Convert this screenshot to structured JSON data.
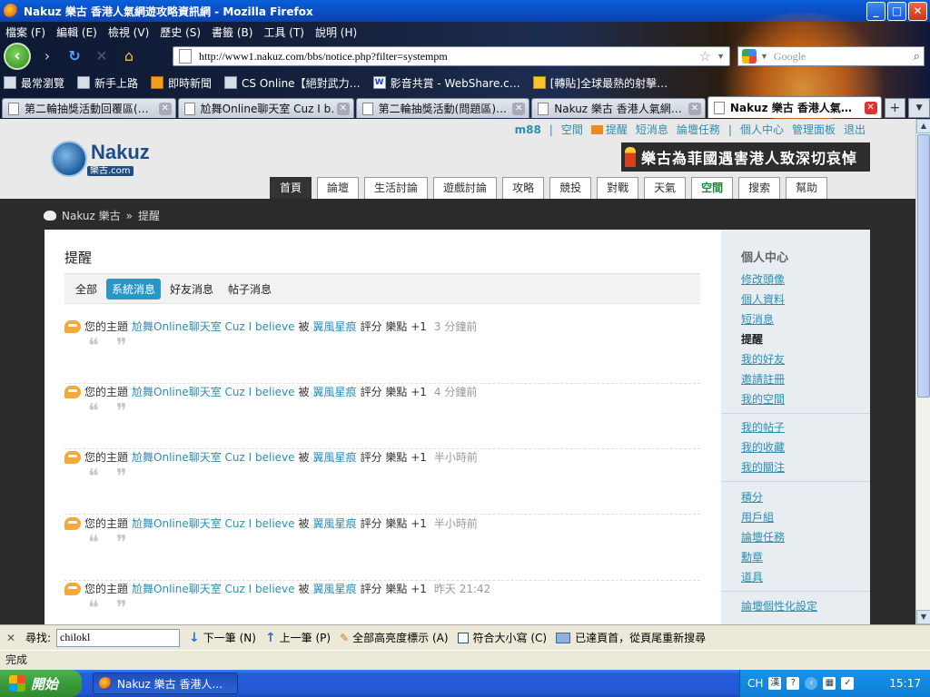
{
  "window": {
    "title": "Nakuz 樂古 香港人氣網遊攻略資訊網 - Mozilla Firefox",
    "minimize": "_",
    "maximize": "□",
    "close": "✕"
  },
  "menu": [
    "檔案 (F)",
    "編輯 (E)",
    "檢視 (V)",
    "歷史 (S)",
    "書籤 (B)",
    "工具 (T)",
    "說明 (H)"
  ],
  "nav": {
    "url": "http://www1.nakuz.com/bbs/notice.php?filter=systempm",
    "search_placeholder": "Google"
  },
  "bookmarks": [
    {
      "label": "最常瀏覽",
      "icon": "page-icon"
    },
    {
      "label": "新手上路",
      "icon": "page-icon"
    },
    {
      "label": "即時新聞",
      "icon": "rss-icon"
    },
    {
      "label": "CS Online【絕對武力…",
      "icon": "page-icon"
    },
    {
      "label": "影音共賞 - WebShare.c…",
      "icon": "w-icon"
    },
    {
      "label": "[轉貼]全球最熱的射擊…",
      "icon": "mail-icon"
    }
  ],
  "tabs": [
    {
      "label": "第二輪抽獎活動回覆區(…",
      "active": false
    },
    {
      "label": "尬舞Online聊天室 Cuz I b…",
      "active": false
    },
    {
      "label": "第二輪抽獎活動(問題區)…",
      "active": false
    },
    {
      "label": "Nakuz 樂古 香港人氣網…",
      "active": false
    },
    {
      "label": "Nakuz 樂古 香港人氣…",
      "active": true
    }
  ],
  "site": {
    "toplinks": {
      "user": "m88",
      "space": "空間",
      "remind": "提醒",
      "pm": "短消息",
      "tasks": "論壇任務",
      "center": "個人中心",
      "admin": "管理面板",
      "logout": "退出",
      "sep": "|"
    },
    "logo_text": "Nakuz",
    "logo_sub": "樂古.com",
    "banner": "樂古為菲國遇害港人致深切哀悼",
    "navtabs": [
      "首頁",
      "論壇",
      "生活討論",
      "遊戲討論",
      "攻略",
      "競投",
      "對戰",
      "天氣",
      "空間",
      "搜索",
      "幫助"
    ],
    "breadcrumb": {
      "home": "Nakuz 樂古",
      "sep": "»",
      "current": "提醒"
    }
  },
  "main": {
    "title": "提醒",
    "filters": [
      "全部",
      "系統消息",
      "好友消息",
      "帖子消息"
    ],
    "active_filter": 1,
    "notices": [
      {
        "pre": "您的主題",
        "topic": "尬舞Online聊天室 Cuz I believe",
        "by": "被",
        "user": "翼風星痕",
        "action": "評分 樂點 +1",
        "time": "3 分鐘前",
        "quote": "❝ ❞"
      },
      {
        "pre": "您的主題",
        "topic": "尬舞Online聊天室 Cuz I believe",
        "by": "被",
        "user": "翼風星痕",
        "action": "評分 樂點 +1",
        "time": "4 分鐘前",
        "quote": "❝ ❞"
      },
      {
        "pre": "您的主題",
        "topic": "尬舞Online聊天室 Cuz I believe",
        "by": "被",
        "user": "翼風星痕",
        "action": "評分 樂點 +1",
        "time": "半小時前",
        "quote": "❝ ❞"
      },
      {
        "pre": "您的主題",
        "topic": "尬舞Online聊天室 Cuz I believe",
        "by": "被",
        "user": "翼風星痕",
        "action": "評分 樂點 +1",
        "time": "半小時前",
        "quote": "❝ ❞"
      },
      {
        "pre": "您的主題",
        "topic": "尬舞Online聊天室 Cuz I believe",
        "by": "被",
        "user": "翼風星痕",
        "action": "評分 樂點 +1",
        "time": "昨天 21:42",
        "quote": "❝ ❞"
      }
    ]
  },
  "sidebar": {
    "title": "個人中心",
    "groups": [
      [
        "修改頭像",
        "個人資料",
        "短消息",
        "提醒",
        "我的好友",
        "邀請註冊",
        "我的空間"
      ],
      [
        "我的帖子",
        "我的收藏",
        "我的關注"
      ],
      [
        "積分",
        "用戶組",
        "論壇任務",
        "勳章",
        "道具"
      ],
      [
        "論壇個性化設定"
      ]
    ],
    "current": "提醒"
  },
  "findbar": {
    "label": "尋找:",
    "value": "chilokl",
    "next": "下一筆 (N)",
    "prev": "上一筆 (P)",
    "highlight": "全部高亮度標示 (A)",
    "match_case": "符合大小寫 (C)",
    "status": "已達頁首，從頁尾重新搜尋"
  },
  "statusbar": {
    "text": "完成"
  },
  "taskbar": {
    "start": "開始",
    "task": "Nakuz 樂古 香港人...",
    "lang": "CH",
    "clock": "15:17"
  }
}
